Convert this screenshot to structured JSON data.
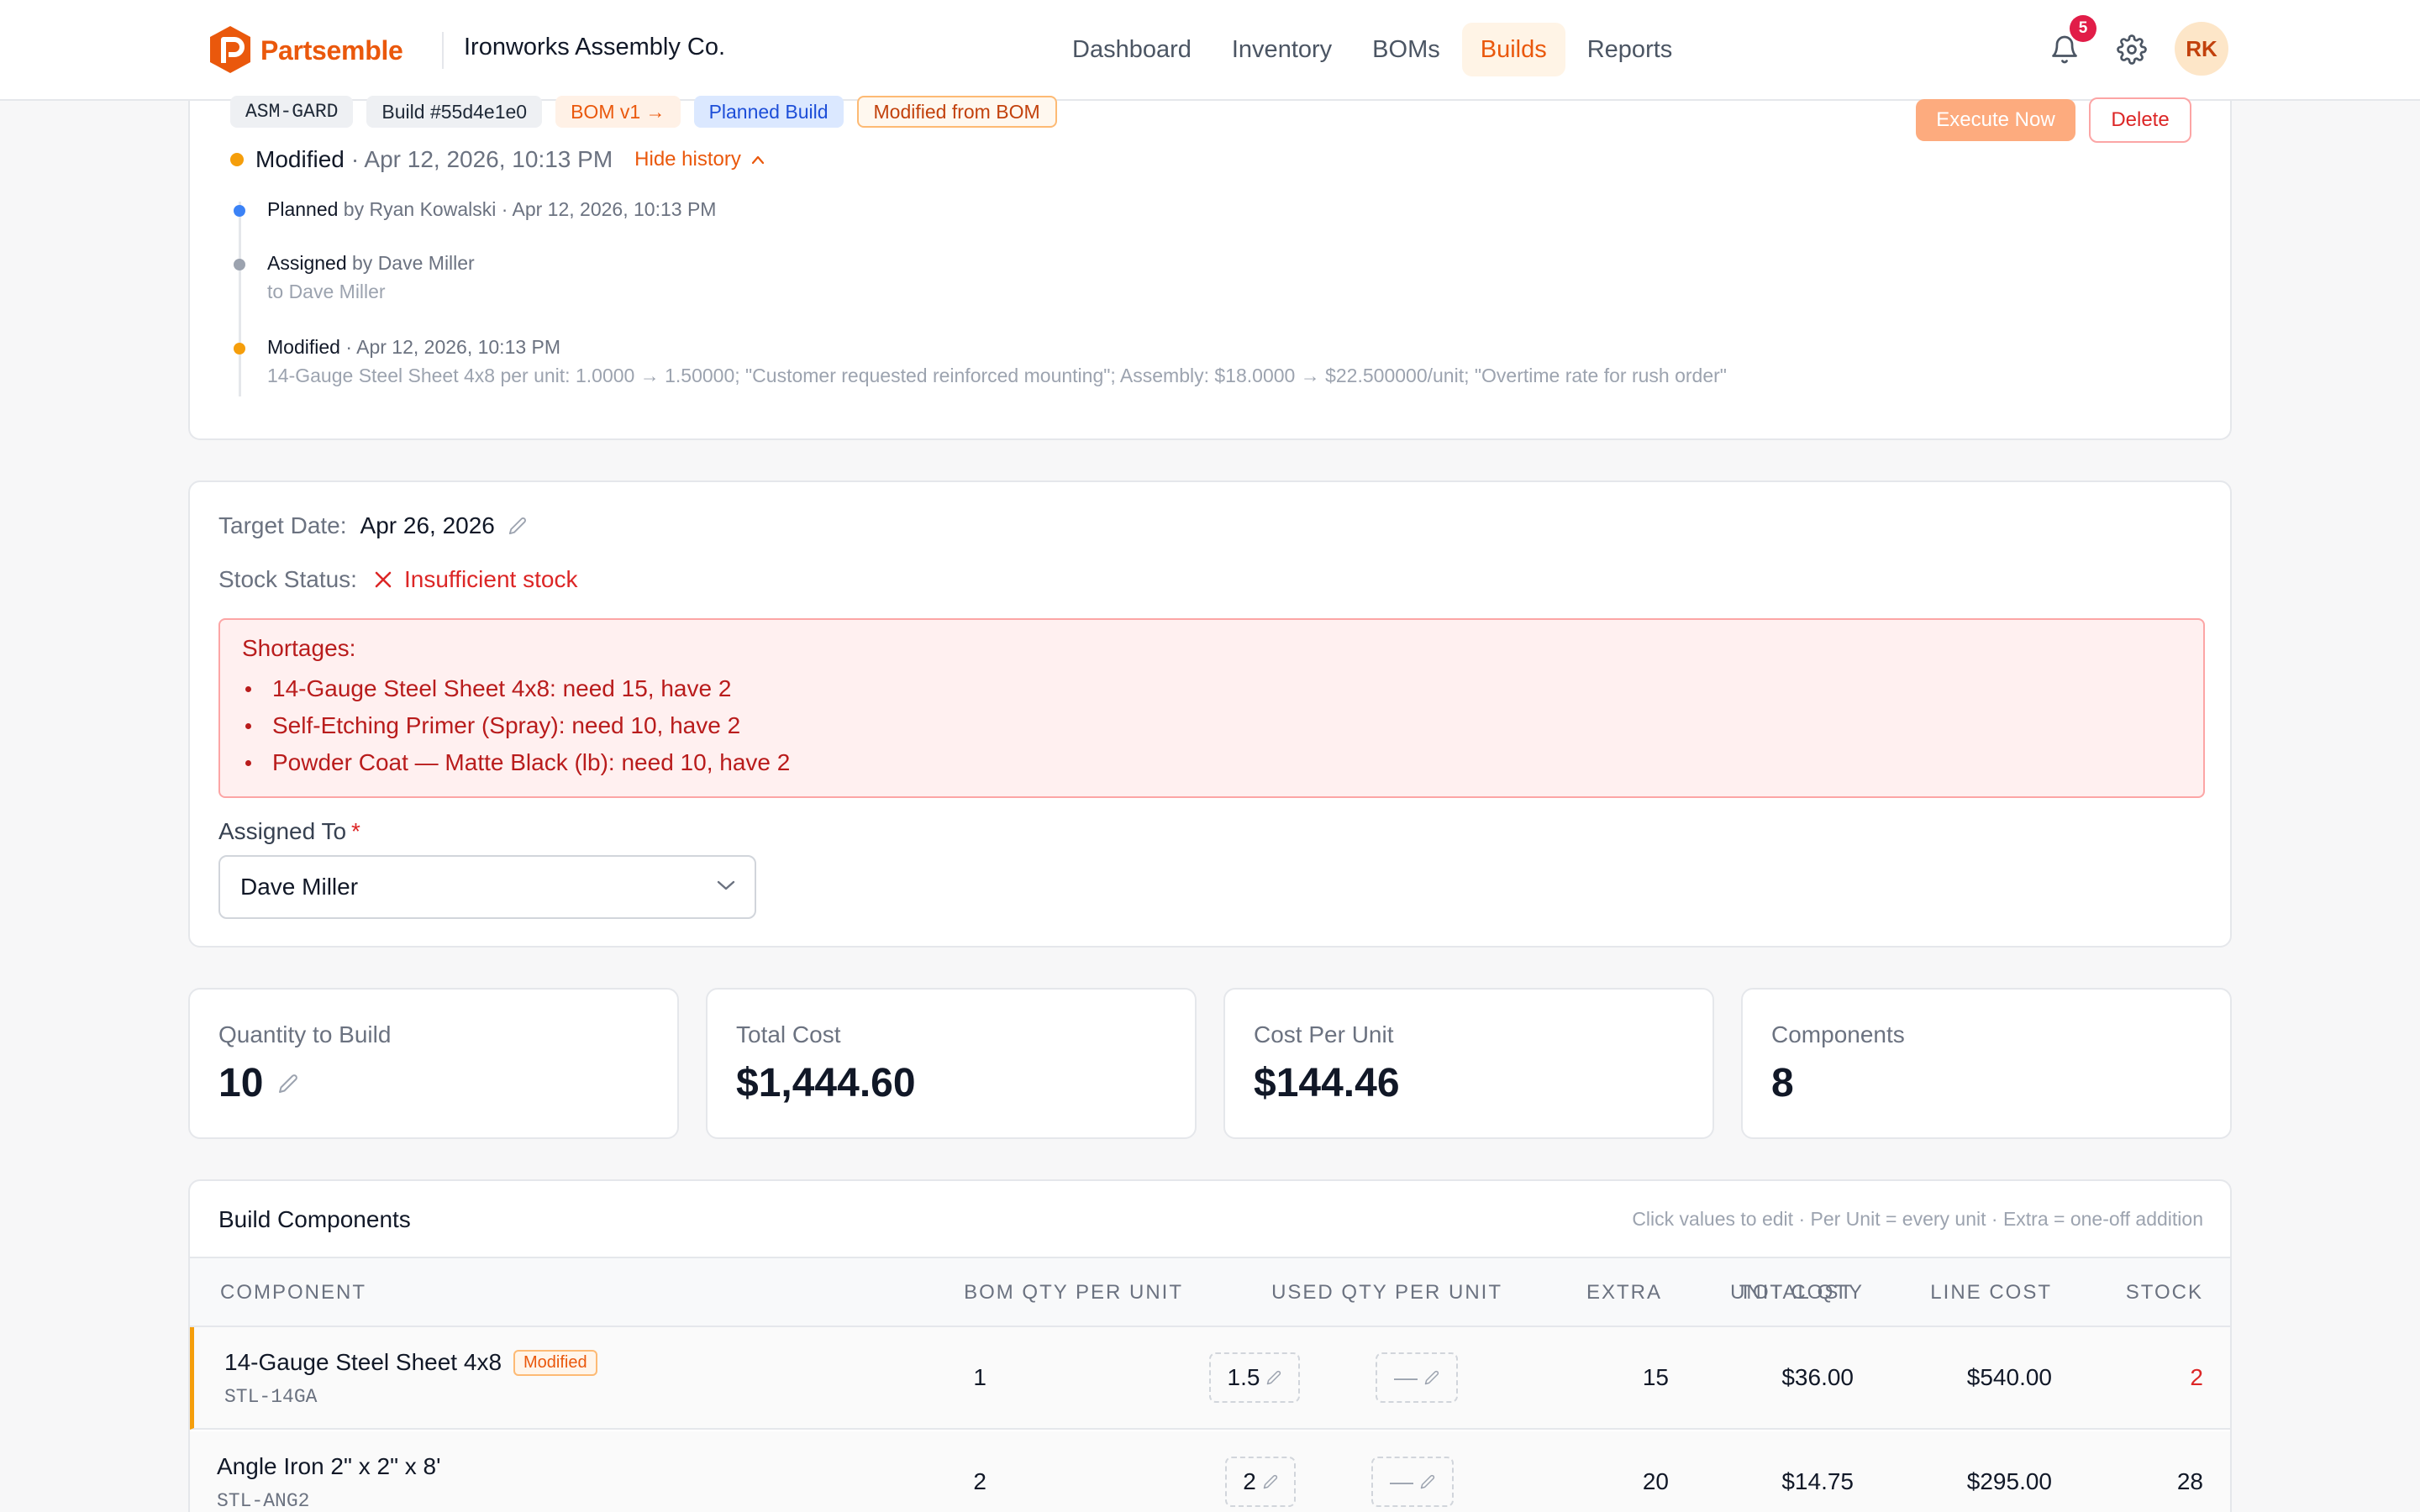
{
  "header": {
    "brand": "Partsemble",
    "company": "Ironworks Assembly Co.",
    "nav": [
      {
        "label": "Dashboard",
        "active": false
      },
      {
        "label": "Inventory",
        "active": false
      },
      {
        "label": "BOMs",
        "active": false
      },
      {
        "label": "Builds",
        "active": true
      },
      {
        "label": "Reports",
        "active": false
      }
    ],
    "notification_count": "5",
    "avatar_initials": "RK",
    "icons": [
      "bell-icon",
      "gear-icon"
    ]
  },
  "build": {
    "chips": {
      "sku": "ASM-GARD",
      "build_id": "Build #55d4e1e0",
      "bom": "BOM v1 →",
      "type": "Planned Build",
      "modified": "Modified from BOM"
    },
    "actions": {
      "execute": "Execute Now",
      "delete": "Delete"
    },
    "status": {
      "label": "Modified",
      "time": "· Apr 12, 2026, 10:13 PM",
      "toggle": "Hide history"
    },
    "history": [
      {
        "action": "Planned",
        "meta": " by Ryan Kowalski · Apr 12, 2026, 10:13 PM",
        "sub": "",
        "color": "#3b82f6"
      },
      {
        "action": "Assigned",
        "meta": " by Dave Miller",
        "sub": "to Dave Miller",
        "color": "#9ca3af"
      },
      {
        "action": "Modified",
        "meta": " · Apr 12, 2026, 10:13 PM",
        "sub": "14-Gauge Steel Sheet 4x8 per unit: 1.0000 → 1.50000; \"Customer requested reinforced mounting\"; Assembly: $18.0000 → $22.500000/unit; \"Overtime rate for rush order\"",
        "color": "#f59e0b"
      }
    ]
  },
  "details": {
    "target_date_label": "Target Date:",
    "target_date": "Apr 26, 2026",
    "stock_status_label": "Stock Status:",
    "stock_status": "Insufficient stock",
    "shortages_title": "Shortages:",
    "shortages": [
      "14-Gauge Steel Sheet 4x8: need 15, have 2",
      "Self-Etching Primer (Spray): need 10, have 2",
      "Powder Coat — Matte Black (lb): need 10, have 2"
    ],
    "assigned_label": "Assigned To",
    "assigned_required": "*",
    "assigned_value": "Dave Miller"
  },
  "stats": [
    {
      "label": "Quantity to Build",
      "value": "10"
    },
    {
      "label": "Total Cost",
      "value": "$1,444.60"
    },
    {
      "label": "Cost Per Unit",
      "value": "$144.46"
    },
    {
      "label": "Components",
      "value": "8"
    }
  ],
  "components": {
    "title": "Build Components",
    "hint": "Click values to edit · Per Unit = every unit · Extra = one-off addition",
    "columns": [
      "COMPONENT",
      "BOM QTY PER UNIT",
      "USED QTY PER UNIT",
      "EXTRA",
      "TOTAL QTY",
      "UNIT COST",
      "LINE COST",
      "STOCK"
    ],
    "rows": [
      {
        "name": "14-Gauge Steel Sheet 4x8",
        "badge": "Modified",
        "sku": "STL-14GA",
        "bom_qty": "1",
        "used_qty": "1.5",
        "extra": "—",
        "total_qty": "15",
        "unit_cost": "$36.00",
        "line_cost": "$540.00",
        "stock": "2"
      },
      {
        "name": "Angle Iron 2\" x 2\" x 8'",
        "badge": "",
        "sku": "STL-ANG2",
        "bom_qty": "2",
        "used_qty": "2",
        "extra": "—",
        "total_qty": "20",
        "unit_cost": "$14.75",
        "line_cost": "$295.00",
        "stock": "28"
      }
    ]
  }
}
